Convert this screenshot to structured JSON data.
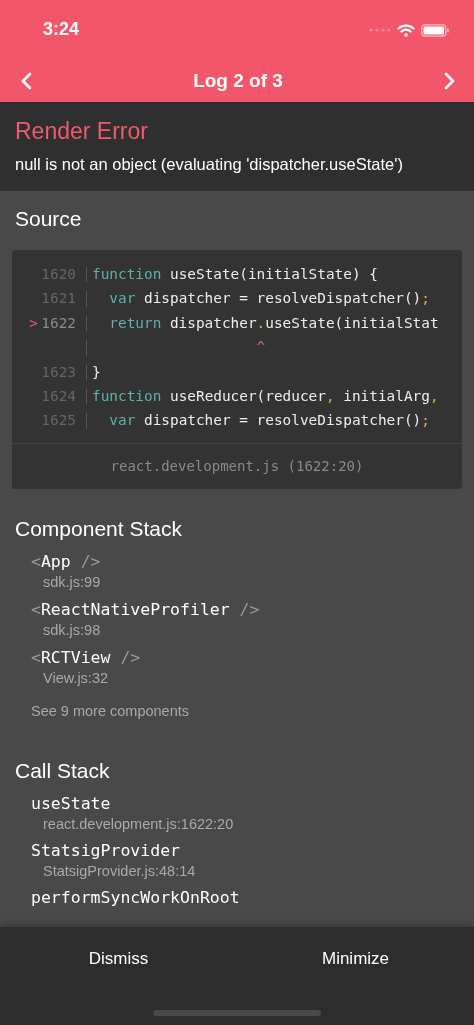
{
  "status_bar": {
    "time": "3:24"
  },
  "nav": {
    "title": "Log 2 of 3"
  },
  "error": {
    "title": "Render Error",
    "message": "null is not an object (evaluating 'dispatcher.useState')"
  },
  "source": {
    "heading": "Source",
    "lines": [
      {
        "number": "1620",
        "selected": false,
        "tokens": [
          {
            "kind": "keyword",
            "text": "function"
          },
          {
            "kind": "plain",
            "text": " useState(initialState) {"
          }
        ]
      },
      {
        "number": "1621",
        "selected": false,
        "indented": true,
        "tokens": [
          {
            "kind": "keyword",
            "text": "var"
          },
          {
            "kind": "plain",
            "text": " dispatcher = resolveDispatcher()"
          },
          {
            "kind": "punct",
            "text": ";"
          }
        ]
      },
      {
        "number": "1622",
        "selected": true,
        "marker": ">",
        "indented": true,
        "tokens": [
          {
            "kind": "keyword",
            "text": "return"
          },
          {
            "kind": "plain",
            "text": " dispatcher"
          },
          {
            "kind": "punct",
            "text": "."
          },
          {
            "kind": "plain",
            "text": "useState(initialStat"
          }
        ]
      },
      {
        "caret": "^"
      },
      {
        "number": "1623",
        "selected": false,
        "tokens": [
          {
            "kind": "plain",
            "text": "}"
          }
        ]
      },
      {
        "number": "1624",
        "selected": false,
        "tokens": [
          {
            "kind": "keyword",
            "text": "function"
          },
          {
            "kind": "plain",
            "text": " useReducer(reducer"
          },
          {
            "kind": "punct",
            "text": ","
          },
          {
            "kind": "plain",
            "text": " initialArg"
          },
          {
            "kind": "punct",
            "text": ","
          }
        ]
      },
      {
        "number": "1625",
        "selected": false,
        "indented": true,
        "tokens": [
          {
            "kind": "keyword",
            "text": "var"
          },
          {
            "kind": "plain",
            "text": " dispatcher = resolveDispatcher()"
          },
          {
            "kind": "punct",
            "text": ";"
          }
        ]
      }
    ],
    "file": "react.development.js (1622:20)"
  },
  "component_stack": {
    "heading": "Component Stack",
    "items": [
      {
        "open": "<",
        "name": "App",
        "close": " />",
        "location": "sdk.js:99"
      },
      {
        "open": "<",
        "name": "ReactNativeProfiler",
        "close": " />",
        "location": "sdk.js:98"
      },
      {
        "open": "<",
        "name": "RCTView",
        "close": " />",
        "location": "View.js:32"
      }
    ],
    "more": "See 9 more components"
  },
  "call_stack": {
    "heading": "Call Stack",
    "frames": [
      {
        "name": "useState",
        "location": "react.development.js:1622:20"
      },
      {
        "name": "StatsigProvider",
        "location": "StatsigProvider.js:48:14"
      },
      {
        "name": "performSyncWorkOnRoot"
      }
    ]
  },
  "footer": {
    "buttons": [
      "Dismiss",
      "Minimize"
    ]
  }
}
